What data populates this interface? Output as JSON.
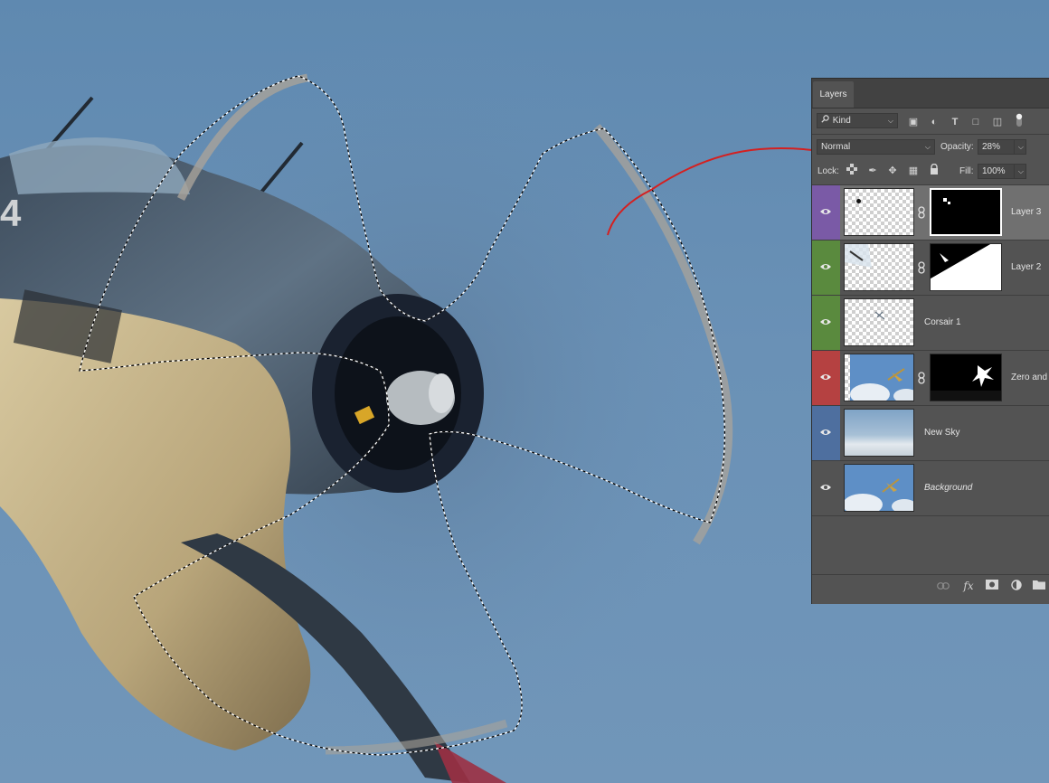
{
  "panel": {
    "tab_label": "Layers",
    "filter_kind": "Kind",
    "blend_mode": "Normal",
    "opacity_label": "Opacity:",
    "opacity_value": "28%",
    "lock_label": "Lock:",
    "fill_label": "Fill:",
    "fill_value": "100%"
  },
  "layers": [
    {
      "name": "Layer 3",
      "color": "#7a5aa6",
      "selected": true,
      "has_mask": true,
      "italic": false
    },
    {
      "name": "Layer 2",
      "color": "#5a8a3e",
      "selected": false,
      "has_mask": true,
      "italic": false
    },
    {
      "name": "Corsair 1",
      "color": "#5a8a3e",
      "selected": false,
      "has_mask": false,
      "italic": false
    },
    {
      "name": "Zero and",
      "color": "#b54141",
      "selected": false,
      "has_mask": true,
      "italic": false
    },
    {
      "name": "New Sky",
      "color": "#4e6f9f",
      "selected": false,
      "has_mask": false,
      "italic": false
    },
    {
      "name": "Background",
      "color": "#535353",
      "selected": false,
      "has_mask": false,
      "italic": true
    }
  ],
  "icons": {
    "search": "search-icon",
    "eye": "eye-icon",
    "link": "chain-link-icon",
    "fx": "fx"
  },
  "colors": {
    "panel_bg": "#535353",
    "sky": "#6a91b6",
    "annotation": "#d42020"
  }
}
